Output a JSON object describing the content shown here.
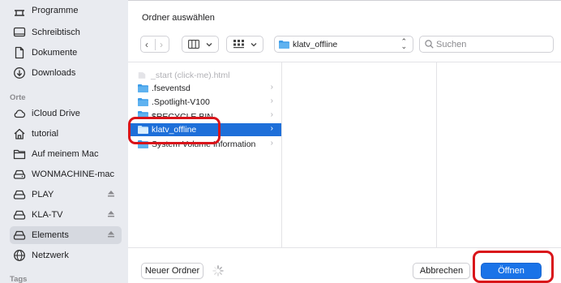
{
  "sidebar": {
    "items": [
      {
        "label": "Programme",
        "icon": "apps-icon"
      },
      {
        "label": "Schreibtisch",
        "icon": "desktop-icon"
      },
      {
        "label": "Dokumente",
        "icon": "document-icon"
      },
      {
        "label": "Downloads",
        "icon": "download-icon"
      }
    ],
    "section_places": "Orte",
    "places": [
      {
        "label": "iCloud Drive",
        "icon": "cloud-icon"
      },
      {
        "label": "tutorial",
        "icon": "home-icon"
      },
      {
        "label": "Auf meinem Mac",
        "icon": "folder-icon"
      },
      {
        "label": "WONMACHINE-mac",
        "icon": "network-drive-icon"
      },
      {
        "label": "PLAY",
        "icon": "drive-icon",
        "eject": true
      },
      {
        "label": "KLA-TV",
        "icon": "drive-icon",
        "eject": true
      },
      {
        "label": "Elements",
        "icon": "drive-icon",
        "eject": true,
        "selected": true
      },
      {
        "label": "Netzwerk",
        "icon": "globe-icon"
      }
    ],
    "section_tags": "Tags"
  },
  "dialog": {
    "title": "Ordner auswählen",
    "path_label": "klatv_offline",
    "search_placeholder": "Suchen"
  },
  "files": [
    {
      "name": "_start (click-me).html",
      "kind": "file",
      "dim": true
    },
    {
      "name": ".fseventsd",
      "kind": "folder"
    },
    {
      "name": ".Spotlight-V100",
      "kind": "folder"
    },
    {
      "name": "$RECYCLE.BIN",
      "kind": "folder"
    },
    {
      "name": "klatv_offline",
      "kind": "folder",
      "selected": true
    },
    {
      "name": "System Volume Information",
      "kind": "folder"
    }
  ],
  "buttons": {
    "new_folder": "Neuer Ordner",
    "cancel": "Abbrechen",
    "open": "Öffnen"
  },
  "colors": {
    "accent": "#1a73e8",
    "selection": "#1e6fd9",
    "folder": "#3b9be8",
    "annotation": "#d9141a"
  }
}
